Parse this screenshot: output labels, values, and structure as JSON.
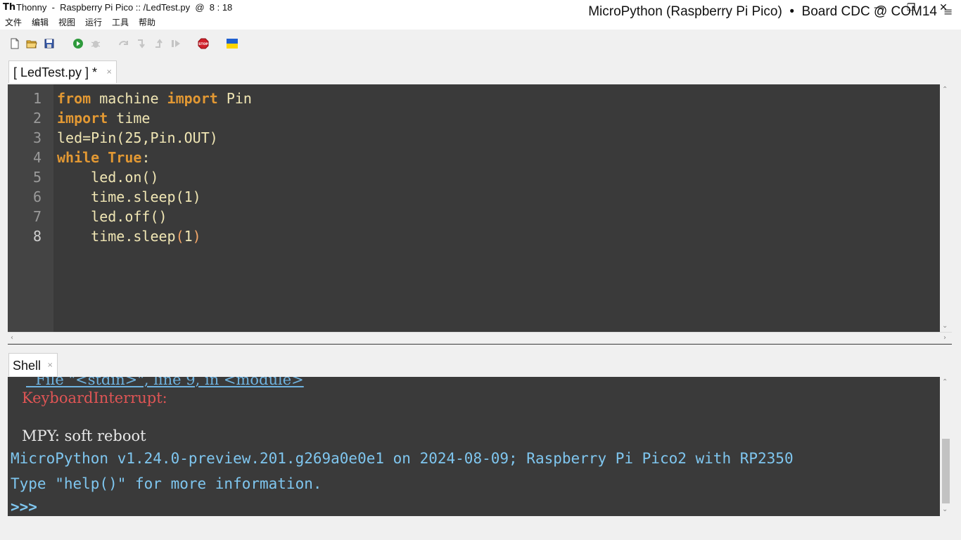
{
  "window": {
    "title": "Thonny  -  Raspberry Pi Pico :: /LedTest.py  @  8 : 18",
    "app_icon_glyph": "Th",
    "controls": {
      "minimize": "—",
      "restore": "❐",
      "close": "✕"
    }
  },
  "menubar": {
    "items": [
      "文件",
      "编辑",
      "视图",
      "运行",
      "工具",
      "帮助"
    ]
  },
  "toolbar": {
    "buttons": [
      {
        "name": "new-file",
        "icon": "new-file-icon"
      },
      {
        "name": "open-file",
        "icon": "open-folder-icon"
      },
      {
        "name": "save-file",
        "icon": "save-icon"
      },
      {
        "name": "run",
        "icon": "run-icon",
        "color": "#2e9a3c"
      },
      {
        "name": "debug",
        "icon": "bug-icon",
        "enabled": false
      },
      {
        "name": "step-over",
        "icon": "step-over-icon",
        "enabled": false
      },
      {
        "name": "step-into",
        "icon": "step-into-icon",
        "enabled": false
      },
      {
        "name": "step-out",
        "icon": "step-out-icon",
        "enabled": false
      },
      {
        "name": "resume",
        "icon": "resume-icon",
        "enabled": false
      },
      {
        "name": "stop",
        "icon": "stop-icon",
        "color": "#d0202a",
        "label": "STOP"
      },
      {
        "name": "ukraine-flag",
        "icon": "flag-icon",
        "colors": [
          "#1f5fd0",
          "#ffd500"
        ]
      }
    ]
  },
  "editor": {
    "tab_label": "[ LedTest.py ] *",
    "tab_close": "×",
    "line_numbers": [
      "1",
      "2",
      "3",
      "4",
      "5",
      "6",
      "7",
      "8"
    ],
    "lines": [
      [
        {
          "t": "from",
          "c": "kw"
        },
        {
          "t": " machine ",
          "c": ""
        },
        {
          "t": "import",
          "c": "kw"
        },
        {
          "t": " Pin",
          "c": ""
        }
      ],
      [
        {
          "t": "import",
          "c": "kw"
        },
        {
          "t": " time",
          "c": ""
        }
      ],
      [
        {
          "t": "led=Pin(25,Pin.OUT)",
          "c": ""
        }
      ],
      [
        {
          "t": "while",
          "c": "kw"
        },
        {
          "t": " ",
          "c": ""
        },
        {
          "t": "True",
          "c": "kw"
        },
        {
          "t": ":",
          "c": ""
        }
      ],
      [
        {
          "t": "    led.on()",
          "c": ""
        }
      ],
      [
        {
          "t": "    time.sleep(1)",
          "c": ""
        }
      ],
      [
        {
          "t": "    led.off()",
          "c": ""
        }
      ],
      [
        {
          "t": "    time.sleep",
          "c": ""
        },
        {
          "t": "(",
          "c": "br"
        },
        {
          "t": "1",
          "c": ""
        },
        {
          "t": ")",
          "c": "br"
        }
      ]
    ],
    "colors": {
      "background": "#3a3a3a",
      "gutter": "#444444",
      "text": "#f0e6b4",
      "keyword": "#e29833",
      "bracket": "#f5a86a",
      "line_number": "#9a9a9a"
    }
  },
  "shell": {
    "tab_label": "Shell",
    "tab_close": "×",
    "lines": {
      "traceback_link": "  File \"<stdin>\", line 9, in <module>",
      "error": "KeyboardInterrupt: ",
      "reboot": "MPY: soft reboot",
      "banner": "MicroPython v1.24.0-preview.201.g269a0e0e1 on 2024-08-09; Raspberry Pi Pico2 with RP2350",
      "help": "Type \"help()\" for more information.",
      "prompt": ">>> "
    },
    "colors": {
      "link": "#6fb3e0",
      "error": "#e05555",
      "text": "#e8e8e8",
      "banner": "#7fc6ef",
      "prompt": "#7fc6ef"
    }
  },
  "statusbar": {
    "text": "MicroPython (Raspberry Pi Pico)  •  Board CDC @ COM14",
    "menu_icon": "≡"
  }
}
